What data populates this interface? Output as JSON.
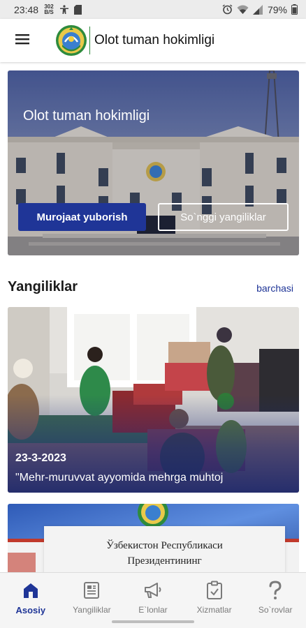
{
  "status_bar": {
    "time": "23:48",
    "data_rate_top": "302",
    "data_rate_bottom": "B/S",
    "battery": "79%"
  },
  "app_bar": {
    "title": "Olot tuman hokimligi",
    "menu_icon": "hamburger-menu-icon",
    "logo_icon": "uzbekistan-emblem-icon"
  },
  "hero": {
    "title": "Olot tuman hokimligi",
    "primary_button": "Murojaat yuborish",
    "secondary_button": "So`nggi yangiliklar"
  },
  "news_section": {
    "title": "Yangiliklar",
    "see_all": "barchasi",
    "items": [
      {
        "date": "23-3-2023",
        "headline": "\"Mehr-muruvvat ayyomida mehrga muhtoj"
      },
      {
        "doc_line1": "Ўзбекистон Республикаси",
        "doc_line2": "Президентининг"
      }
    ]
  },
  "bottom_nav": {
    "items": [
      {
        "label": "Asosiy",
        "icon": "home-icon",
        "active": true
      },
      {
        "label": "Yangiliklar",
        "icon": "newspaper-icon",
        "active": false
      },
      {
        "label": "E`lonlar",
        "icon": "megaphone-icon",
        "active": false
      },
      {
        "label": "Xizmatlar",
        "icon": "clipboard-check-icon",
        "active": false
      },
      {
        "label": "So`rovlar",
        "icon": "question-mark-icon",
        "active": false
      }
    ]
  },
  "colors": {
    "accent": "#1f3597",
    "emblem_green": "#2e8b3c"
  }
}
